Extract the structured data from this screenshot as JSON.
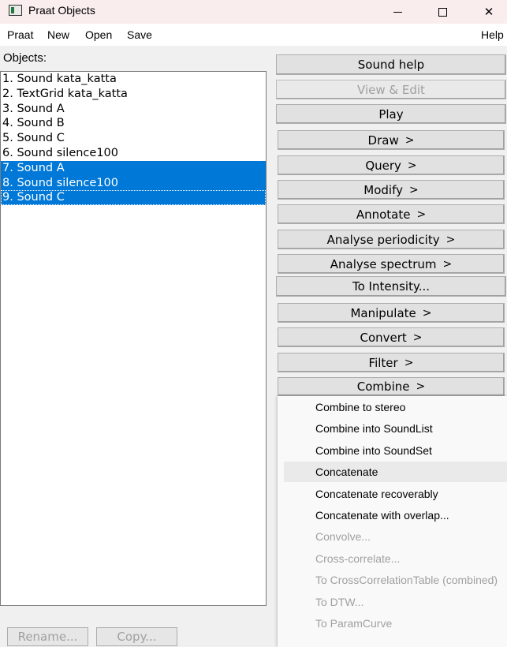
{
  "window": {
    "title": "Praat Objects",
    "controls": {
      "minimize": "minimize-icon",
      "maximize": "maximize-icon",
      "close": "✕"
    }
  },
  "menubar": {
    "items": [
      "Praat",
      "New",
      "Open",
      "Save"
    ],
    "help": "Help"
  },
  "objects": {
    "label": "Objects:",
    "items": [
      {
        "label": "1. Sound kata_katta",
        "selected": false
      },
      {
        "label": "2. TextGrid kata_katta",
        "selected": false
      },
      {
        "label": "3. Sound A",
        "selected": false
      },
      {
        "label": "4. Sound B",
        "selected": false
      },
      {
        "label": "5. Sound C",
        "selected": false
      },
      {
        "label": "6. Sound silence100",
        "selected": false
      },
      {
        "label": "7. Sound A",
        "selected": true
      },
      {
        "label": "8. Sound silence100",
        "selected": true
      },
      {
        "label": "9. Sound C",
        "selected": true
      }
    ]
  },
  "dynamic_menu": {
    "buttons": [
      {
        "label": "Sound help",
        "arrow": "",
        "enabled": true
      },
      {
        "label": "View & Edit",
        "arrow": "",
        "enabled": false
      },
      {
        "label": "Play",
        "arrow": "",
        "enabled": true
      },
      {
        "label": "Draw",
        "arrow": ">",
        "enabled": true
      },
      {
        "label": "Query",
        "arrow": ">",
        "enabled": true
      },
      {
        "label": "Modify",
        "arrow": ">",
        "enabled": true
      },
      {
        "label": "Annotate",
        "arrow": ">",
        "enabled": true
      },
      {
        "label": "Analyse periodicity",
        "arrow": ">",
        "enabled": true
      },
      {
        "label": "Analyse spectrum",
        "arrow": ">",
        "enabled": true
      },
      {
        "label": "To Intensity...",
        "arrow": "",
        "enabled": true
      },
      {
        "label": "Manipulate",
        "arrow": ">",
        "enabled": true
      },
      {
        "label": "Convert",
        "arrow": ">",
        "enabled": true
      },
      {
        "label": "Filter",
        "arrow": ">",
        "enabled": true
      },
      {
        "label": "Combine",
        "arrow": ">",
        "enabled": true
      }
    ]
  },
  "combine_menu": {
    "items": [
      {
        "label": "Combine to stereo",
        "enabled": true,
        "hovered": false
      },
      {
        "label": "Combine into SoundList",
        "enabled": true,
        "hovered": false
      },
      {
        "label": "Combine into SoundSet",
        "enabled": true,
        "hovered": false
      },
      {
        "label": "Concatenate",
        "enabled": true,
        "hovered": true
      },
      {
        "label": "Concatenate recoverably",
        "enabled": true,
        "hovered": false
      },
      {
        "label": "Concatenate with overlap...",
        "enabled": true,
        "hovered": false
      },
      {
        "label": "Convolve...",
        "enabled": false,
        "hovered": false
      },
      {
        "label": "Cross-correlate...",
        "enabled": false,
        "hovered": false
      },
      {
        "label": "To CrossCorrelationTable (combined)",
        "enabled": false,
        "hovered": false
      },
      {
        "label": "To DTW...",
        "enabled": false,
        "hovered": false
      },
      {
        "label": "To ParamCurve",
        "enabled": false,
        "hovered": false
      }
    ]
  },
  "bottom": {
    "rename": "Rename...",
    "copy": "Copy..."
  }
}
